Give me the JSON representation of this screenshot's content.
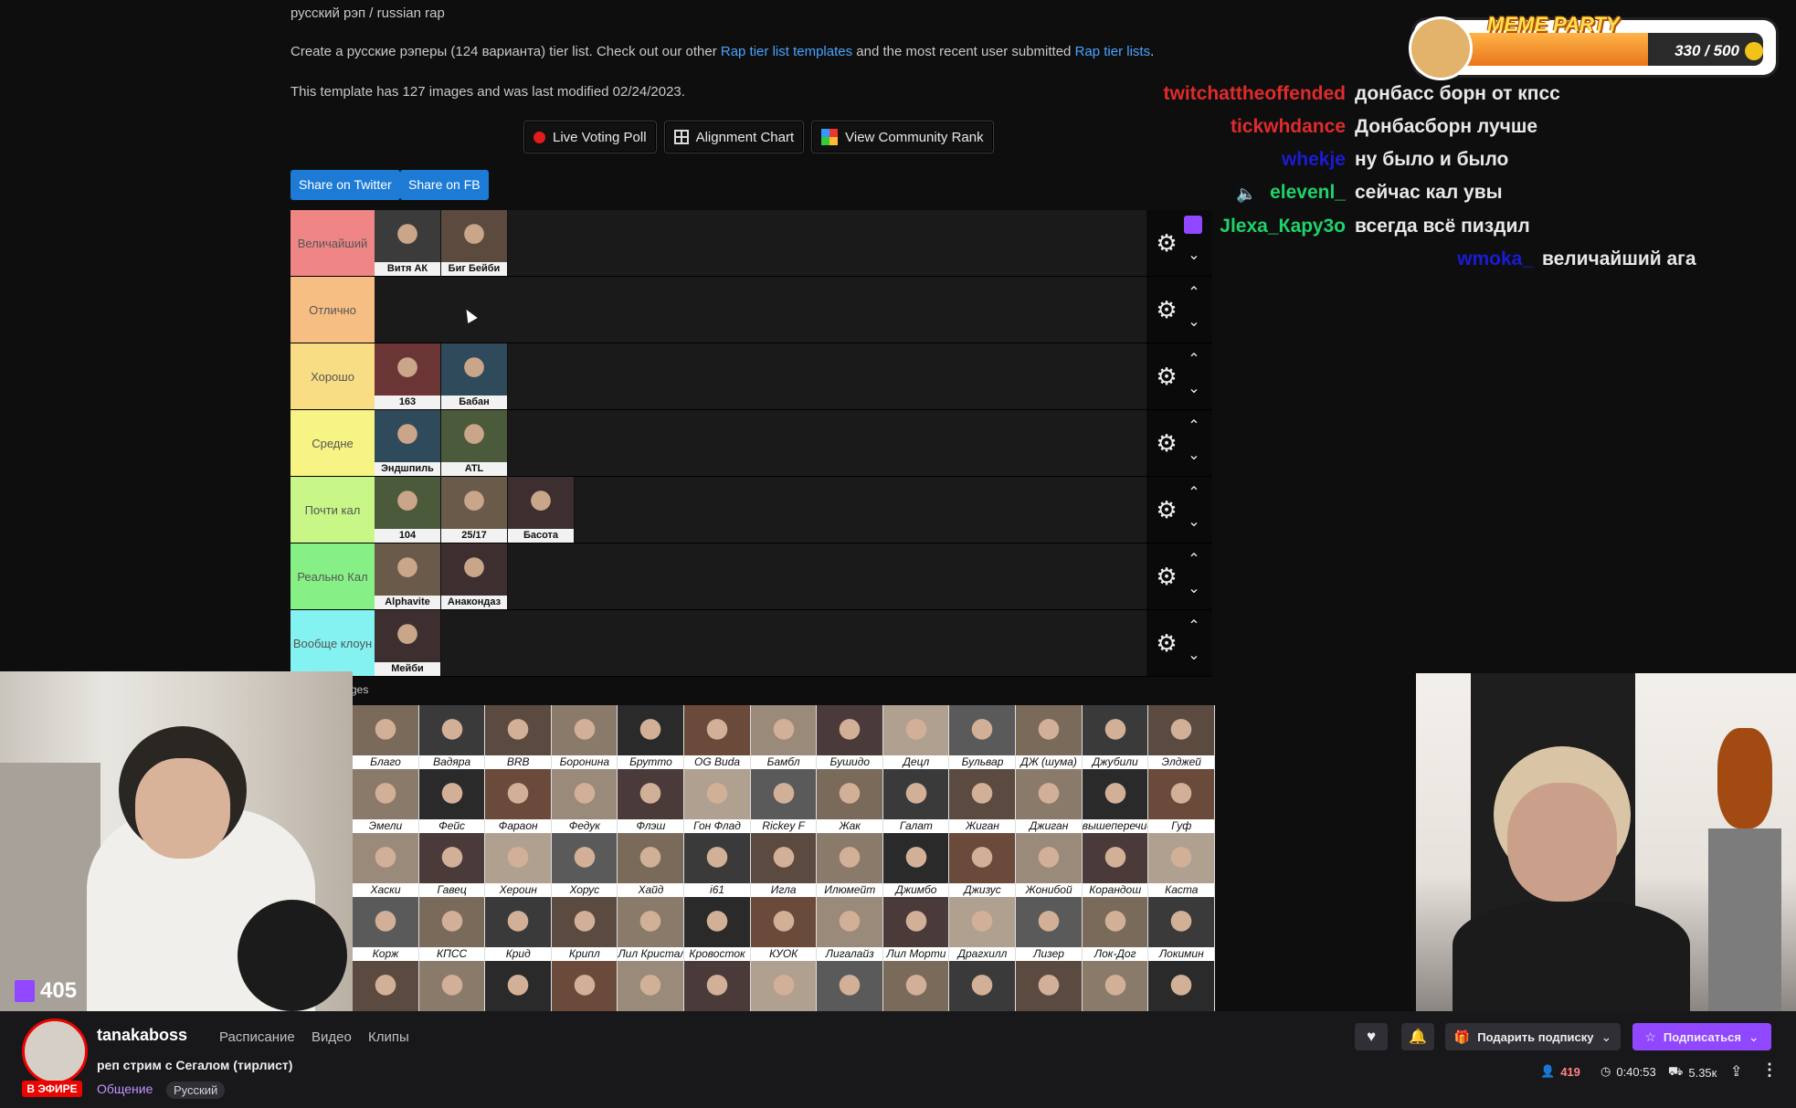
{
  "page": {
    "breadcrumb": "русский рэп / russian rap",
    "intro_pre": "Create a русские рэперы (124 варианта) tier list. Check out our other ",
    "intro_link1": "Rap tier list templates",
    "intro_mid": " and the most recent user submitted ",
    "intro_link2": "Rap tier lists",
    "intro_post": ".",
    "template_info": "This template has 127 images and was last modified 02/24/2023.",
    "buttons": {
      "live_poll": "Live Voting Poll",
      "alignment": "Alignment Chart",
      "community": "View Community Rank"
    },
    "share_twitter": "Share on Twitter",
    "share_fb": "Share on FB",
    "pool_label": "ges"
  },
  "tiers": [
    {
      "label": "Величайший",
      "color": "#f08585",
      "items": [
        "Витя АК",
        "Биг Бейби"
      ],
      "up": false
    },
    {
      "label": "Отлично",
      "color": "#f7be84",
      "items": [],
      "up": true
    },
    {
      "label": "Хорошо",
      "color": "#f9dd84",
      "items": [
        "163",
        "Бабан"
      ],
      "up": true
    },
    {
      "label": "Средне",
      "color": "#f7f384",
      "items": [
        "Эндшпиль",
        "ATL"
      ],
      "up": true
    },
    {
      "label": "Почти кал",
      "color": "#c8f687",
      "items": [
        "104",
        "25/17",
        "Басота"
      ],
      "up": true
    },
    {
      "label": "Реально Кал",
      "color": "#86f087",
      "items": [
        "Alphavite",
        "Анакондаз"
      ],
      "up": true
    },
    {
      "label": "Вообще клоун",
      "color": "#84f2f1",
      "items": [
        "Мейби"
      ],
      "up": true
    }
  ],
  "pool": [
    [
      "Благо",
      "Вадяра",
      "BRB",
      "Боронина",
      "Брутто",
      "OG Buda",
      "Бамбл",
      "Бушидо",
      "Децл",
      "Бульвар",
      "ДЖ (шума)",
      "Джубили",
      "Элджей"
    ],
    [
      "Эмели",
      "Фейс",
      "Фараон",
      "Федук",
      "Флэш",
      "Гон Флад",
      "Rickey F",
      "Жак",
      "Галат",
      "Жиган",
      "Джиган",
      "вышеперечислить",
      "Гуф"
    ],
    [
      "Хаски",
      "Гавец",
      "Хероин",
      "Хорус",
      "Хайд",
      "i61",
      "Игла",
      "Илюмейт",
      "Джимбо",
      "Джизус",
      "Жонибой",
      "Корандош",
      "Каста"
    ],
    [
      "Корж",
      "КПСС",
      "Крид",
      "Крипл",
      "Лил Кристал",
      "Кровосток",
      "КУОК",
      "Лигалайз",
      "Лил Морти",
      "Драгхилл",
      "Лизер",
      "Лок-Дог",
      "Локимин"
    ],
    [
      "",
      "",
      "",
      "",
      "",
      "",
      "",
      "",
      "",
      "",
      "",
      "",
      ""
    ]
  ],
  "chat": [
    {
      "user": "twitchattheoffended",
      "color": "#e02b2b",
      "msg": "донбасс борн от кпсс"
    },
    {
      "user": "tickwhdance",
      "color": "#e02b2b",
      "msg": "Донбасборн лучше"
    },
    {
      "user": "whekje",
      "color": "#1b1bd6",
      "msg": "ну было и было"
    },
    {
      "user": "elevenl_",
      "color": "#1fd26a",
      "msg": "сейчас кал увы"
    },
    {
      "user": "Jlexa_Кару3о",
      "color": "#1fd26a",
      "msg": "всегда всё пиздил"
    },
    {
      "user": "wmoka_",
      "color": "#1b1bd6",
      "msg": "величайший ага"
    }
  ],
  "meme": {
    "title": "MEME PARTY",
    "count": "330 / 500",
    "progress": 0.66
  },
  "webcam_viewers": "405",
  "channel": {
    "name": "tanakaboss",
    "live_badge": "В ЭФИРЕ",
    "nav": [
      "Расписание",
      "Видео",
      "Клипы"
    ],
    "title": "реп стрим с Сегалом (тирлист)",
    "category": "Общение",
    "tag": "Русский",
    "gift": "Подарить подписку",
    "subscribe": "Подписаться",
    "viewers": "419",
    "uptime": "0:40:53",
    "followers": "5.35к"
  },
  "colors": {
    "accent": "#9147ff",
    "live": "#eb0400",
    "link": "#4aa3ff"
  }
}
